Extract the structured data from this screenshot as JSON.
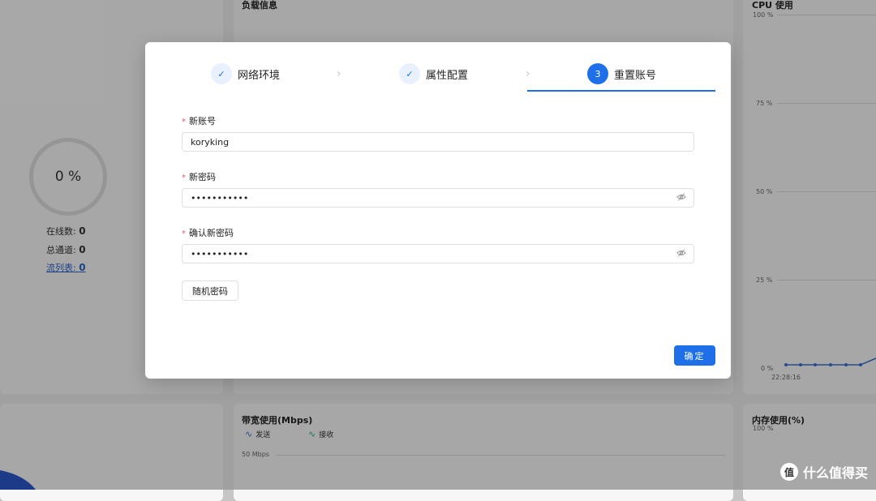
{
  "background": {
    "load_title": "负载信息",
    "cpu_title": "CPU 使用",
    "cpu_ticks": [
      "100 %",
      "75 %",
      "50 %",
      "25 %",
      "0 %"
    ],
    "cpu_time": "22:28:16",
    "ring_value": "0 %",
    "stats": [
      {
        "label": "在线数: ",
        "value": "0"
      },
      {
        "label": "总通道: ",
        "value": "0"
      },
      {
        "label": "流列表: ",
        "value": "0"
      }
    ],
    "bandwidth_title": "带宽使用(Mbps)",
    "legend_send": "发送",
    "legend_recv": "接收",
    "bandwidth_tick": "50 Mbps",
    "memory_title": "内存使用(%)",
    "memory_tick": "100 %",
    "watermark": "什么值得买",
    "watermark_logo": "值"
  },
  "modal": {
    "steps": [
      {
        "label": "网络环境",
        "state": "done",
        "mark": "✓"
      },
      {
        "label": "属性配置",
        "state": "done",
        "mark": "✓"
      },
      {
        "label": "重置账号",
        "state": "active",
        "mark": "3"
      }
    ],
    "chevron": "›",
    "fields": {
      "account": {
        "label": "新账号",
        "value": "koryking",
        "required_mark": "*"
      },
      "password": {
        "label": "新密码",
        "value": "•••••••••••",
        "required_mark": "*"
      },
      "confirm": {
        "label": "确认新密码",
        "value": "•••••••••••",
        "required_mark": "*"
      }
    },
    "random_button": "随机密码",
    "confirm_button": "确定"
  }
}
